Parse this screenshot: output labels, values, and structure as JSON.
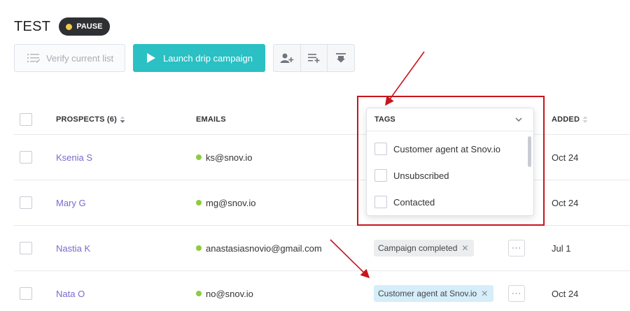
{
  "page": {
    "title": "TEST",
    "status_badge": "PAUSE"
  },
  "toolbar": {
    "verify_label": "Verify current list",
    "launch_label": "Launch drip campaign",
    "icon_buttons": [
      "add-prospect-icon",
      "add-to-list-icon",
      "download-icon"
    ]
  },
  "table": {
    "headers": {
      "prospects": "PROSPECTS (6)",
      "emails": "EMAILS",
      "tags": "TAGS",
      "added": "ADDED"
    },
    "rows": [
      {
        "name": "Ksenia S",
        "email": "ks@snov.io",
        "tag": "",
        "added": "Oct 24"
      },
      {
        "name": "Mary G",
        "email": "mg@snov.io",
        "tag": "",
        "added": "Oct 24"
      },
      {
        "name": "Nastia K",
        "email": "anastasiasnovio@gmail.com",
        "tag": "Campaign completed",
        "added": "Jul 1"
      },
      {
        "name": "Nata O",
        "email": "no@snov.io",
        "tag": "Customer agent at Snov.io",
        "added": "Oct 24"
      }
    ]
  },
  "tags_dropdown": {
    "header": "TAGS",
    "options": [
      "Customer agent at Snov.io",
      "Unsubscribed",
      "Contacted"
    ]
  },
  "colors": {
    "accent": "#2bc0c3",
    "link": "#7b68cf",
    "email_status": "#8ccc3f",
    "annotation": "#c8141c",
    "pause_dot": "#f2c94c"
  }
}
